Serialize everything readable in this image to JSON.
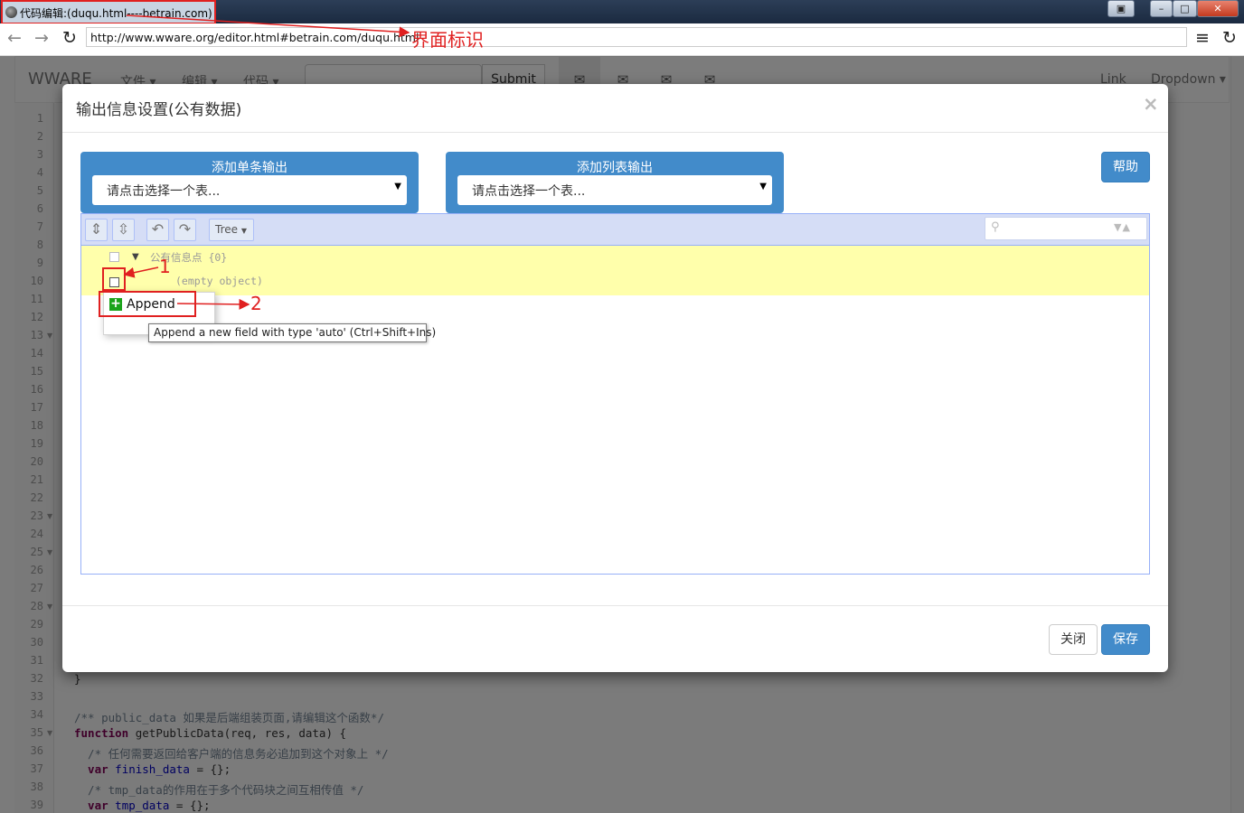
{
  "window": {
    "title": "代码编辑:(duqu.html----betrain.com)",
    "min": "–",
    "max": "□",
    "close": "✕",
    "extra": "▣"
  },
  "browser": {
    "url": "http://www.wware.org/editor.html#betrain.com/duqu.html",
    "back": "←",
    "forward": "→",
    "reload": "↻",
    "menu": "≡",
    "refresh_right": "↻"
  },
  "annotations": {
    "title_note": "界面标识",
    "step1": "1",
    "step2": "2"
  },
  "app": {
    "brand": "WWARE",
    "menus": [
      "文件",
      "编辑",
      "代码"
    ],
    "submit": "Submit",
    "mail_icon": "✉",
    "right_menus": [
      "Link",
      "Dropdown"
    ]
  },
  "editor": {
    "line_count": 39,
    "code": [
      {
        "line": 32,
        "text": "}"
      },
      {
        "line": 34,
        "comment": "/** public_data 如果是后端组装页面,请编辑这个函数*/"
      },
      {
        "line": 35,
        "kw": "function",
        "rest": " getPublicData(req, res, data) {"
      },
      {
        "line": 36,
        "comment": "  /* 任何需要返回给客户端的信息务必追加到这个对象上 */"
      },
      {
        "line": 37,
        "kw": "  var",
        "var": " finish_data",
        "rest": " = {};"
      },
      {
        "line": 38,
        "comment": "  /* tmp_data的作用在于多个代码块之间互相传值 */"
      },
      {
        "line": 39,
        "kw": "  var",
        "var": " tmp_data",
        "rest": " = {};"
      }
    ]
  },
  "modal": {
    "title": "输出信息设置(公有数据)",
    "close": "×",
    "single_output": {
      "title": "添加单条输出",
      "placeholder": "请点击选择一个表..."
    },
    "list_output": {
      "title": "添加列表输出",
      "placeholder": "请点击选择一个表..."
    },
    "help": "帮助",
    "footer": {
      "close": "关闭",
      "save": "保存"
    }
  },
  "json_editor": {
    "mode": "Tree",
    "root_key": "公有信息点",
    "root_count": "{0}",
    "empty": "(empty object)",
    "context_menu": {
      "append": "Append"
    },
    "tooltip": "Append a new field with type 'auto' (Ctrl+Shift+Ins)"
  }
}
